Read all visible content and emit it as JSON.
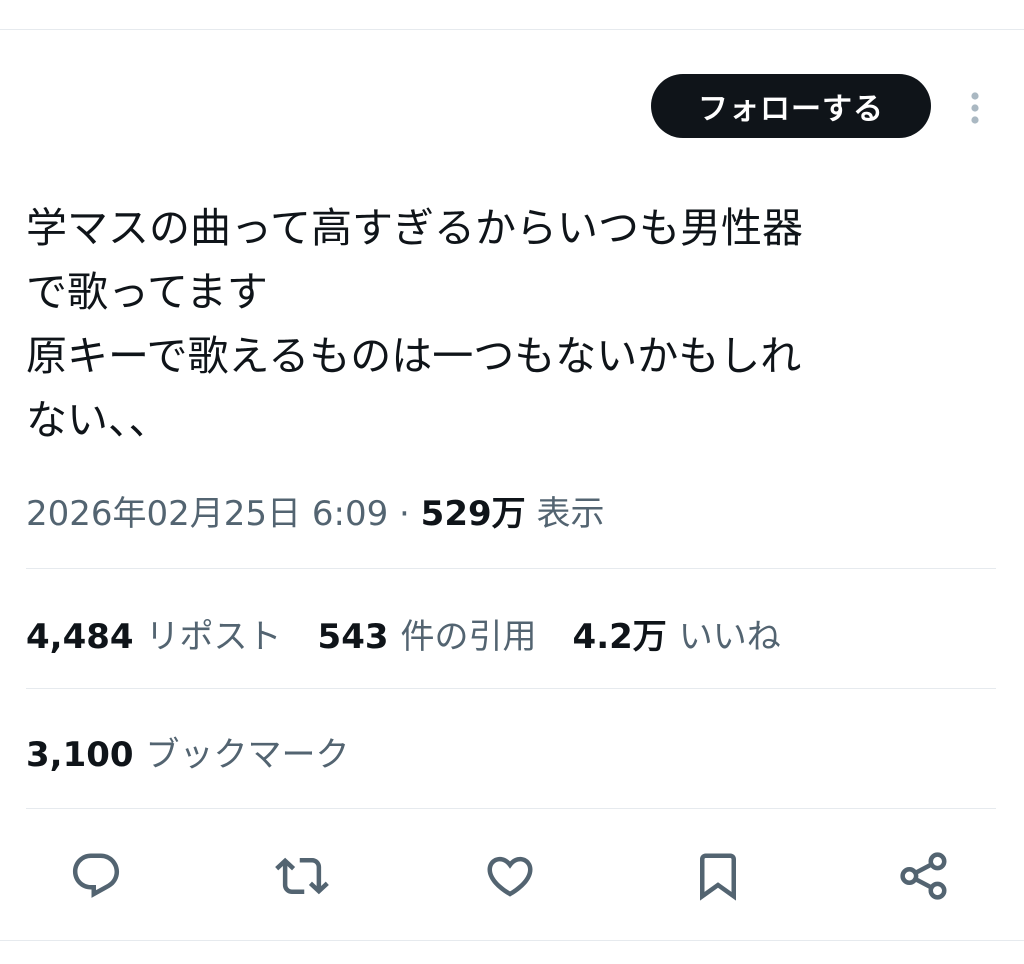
{
  "header": {
    "follow_label": "フォローする",
    "more_icon": "more-vertical-icon"
  },
  "tweet": {
    "text": "学マスの曲って高すぎるからいつも男性器\nで歌ってます\n原キーで歌えるものは一つもないかもしれ\nない、、",
    "timestamp": "2026年02月25日 6:09",
    "separator": "·",
    "views_count": "529万",
    "views_label": "表示"
  },
  "stats": {
    "reposts": {
      "count": "4,484",
      "label": "リポスト"
    },
    "quotes": {
      "count": "543",
      "label": "件の引用"
    },
    "likes": {
      "count": "4.2万",
      "label": "いいね"
    },
    "bookmarks": {
      "count": "3,100",
      "label": "ブックマーク"
    }
  },
  "actions": [
    {
      "name": "reply",
      "icon": "reply-icon"
    },
    {
      "name": "repost",
      "icon": "repost-icon"
    },
    {
      "name": "like",
      "icon": "like-icon"
    },
    {
      "name": "bookmark",
      "icon": "bookmark-icon"
    },
    {
      "name": "share",
      "icon": "share-icon"
    }
  ],
  "colors": {
    "text_primary": "#0f1419",
    "text_secondary": "#536471",
    "divider": "#e6eaee",
    "follow_button_bg": "#0f1419",
    "follow_button_text": "#ffffff",
    "more_icon": "#aab8c2"
  }
}
